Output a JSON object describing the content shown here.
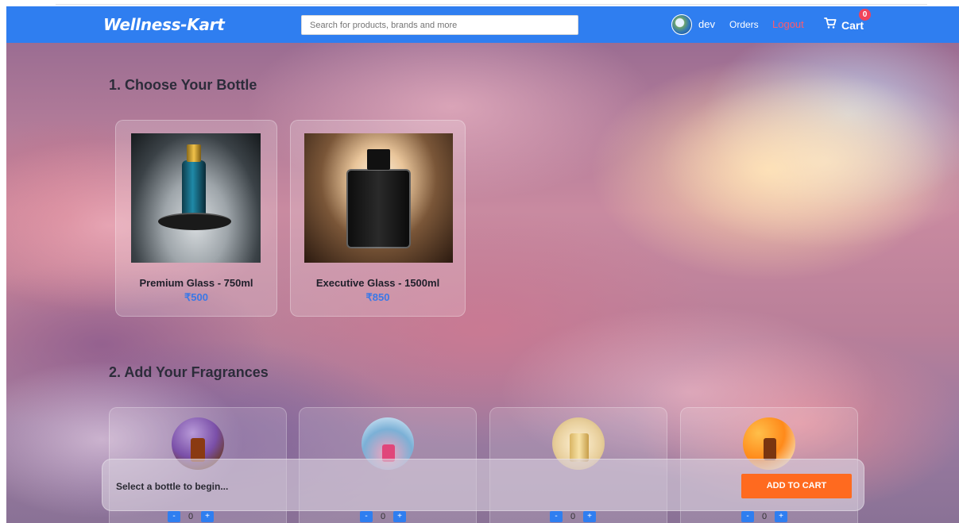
{
  "navbar": {
    "brand": "Wellness-Kart",
    "search_placeholder": "Search for products, brands and more",
    "user_name": "dev",
    "orders_label": "Orders",
    "logout_label": "Logout",
    "cart_label": "Cart",
    "cart_count": "0",
    "brand_color": "#2f7ef0",
    "logout_color": "#ff5a6a"
  },
  "bottle_section": {
    "title": "1. Choose Your Bottle",
    "bottles": [
      {
        "name": "Premium Glass - 750ml",
        "price": "₹500",
        "image": "perfume-bottle-smoke-image"
      },
      {
        "name": "Executive Glass - 1500ml",
        "price": "₹850",
        "image": "perfume-bottle-black-image"
      }
    ],
    "price_color": "#3b78e7"
  },
  "fragrance_section": {
    "title": "2. Add Your Fragrances",
    "fragrances": [
      {
        "image": "lavender-oil-image",
        "qty": "0",
        "minus": "-",
        "plus": "+"
      },
      {
        "image": "flower-perfume-image",
        "qty": "0",
        "minus": "-",
        "plus": "+"
      },
      {
        "image": "gold-perfume-image",
        "qty": "0",
        "minus": "-",
        "plus": "+"
      },
      {
        "image": "orange-oil-image",
        "qty": "0",
        "minus": "-",
        "plus": "+"
      }
    ]
  },
  "action_bar": {
    "message": "Select a bottle to begin...",
    "add_to_cart_label": "ADD TO CART",
    "button_color": "#ff6a1f"
  }
}
